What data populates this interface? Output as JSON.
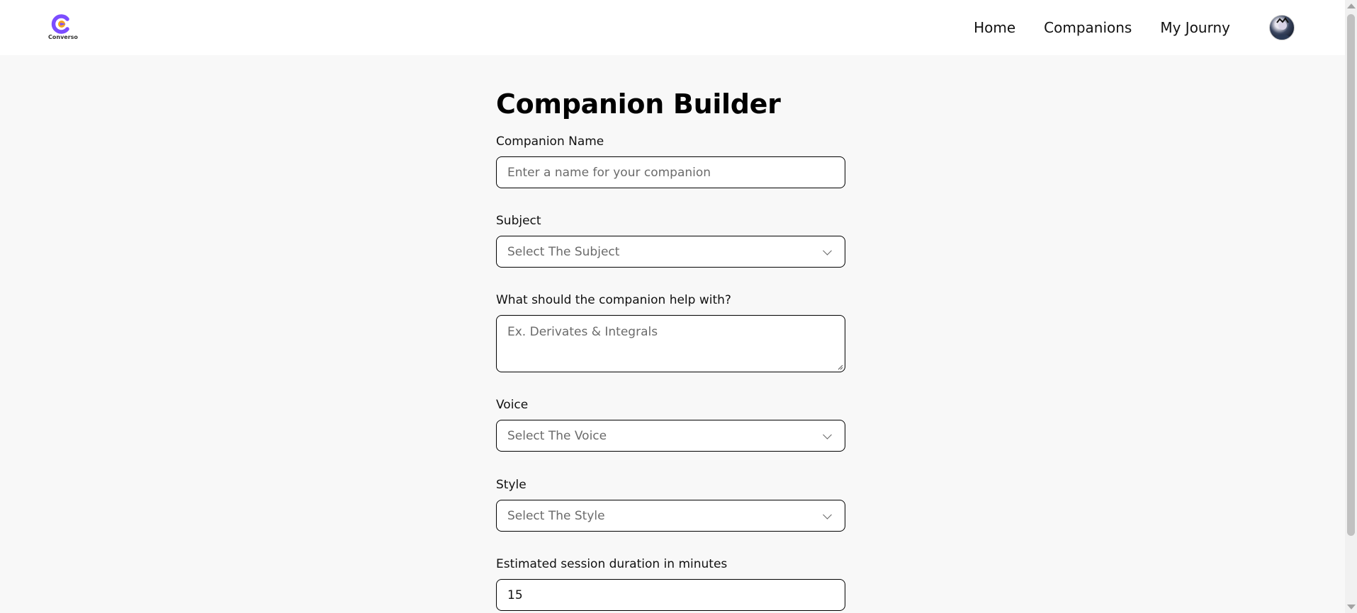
{
  "brand": {
    "logo_text": "Converso",
    "accent_color": "#7c4dff",
    "accent_secondary": "#f5a623"
  },
  "nav": {
    "items": [
      {
        "label": "Home"
      },
      {
        "label": "Companions"
      },
      {
        "label": "My Journy"
      }
    ],
    "avatar_icon": "user-avatar-icon"
  },
  "page": {
    "title": "Companion Builder"
  },
  "form": {
    "name": {
      "label": "Companion Name",
      "placeholder": "Enter a name for your companion"
    },
    "subject": {
      "label": "Subject",
      "placeholder": "Select The Subject"
    },
    "topic": {
      "label": "What should the companion help with?",
      "placeholder": "Ex. Derivates & Integrals"
    },
    "voice": {
      "label": "Voice",
      "placeholder": "Select The Voice"
    },
    "style": {
      "label": "Style",
      "placeholder": "Select The Style"
    },
    "duration": {
      "label": "Estimated session duration in minutes",
      "value": "15"
    }
  }
}
